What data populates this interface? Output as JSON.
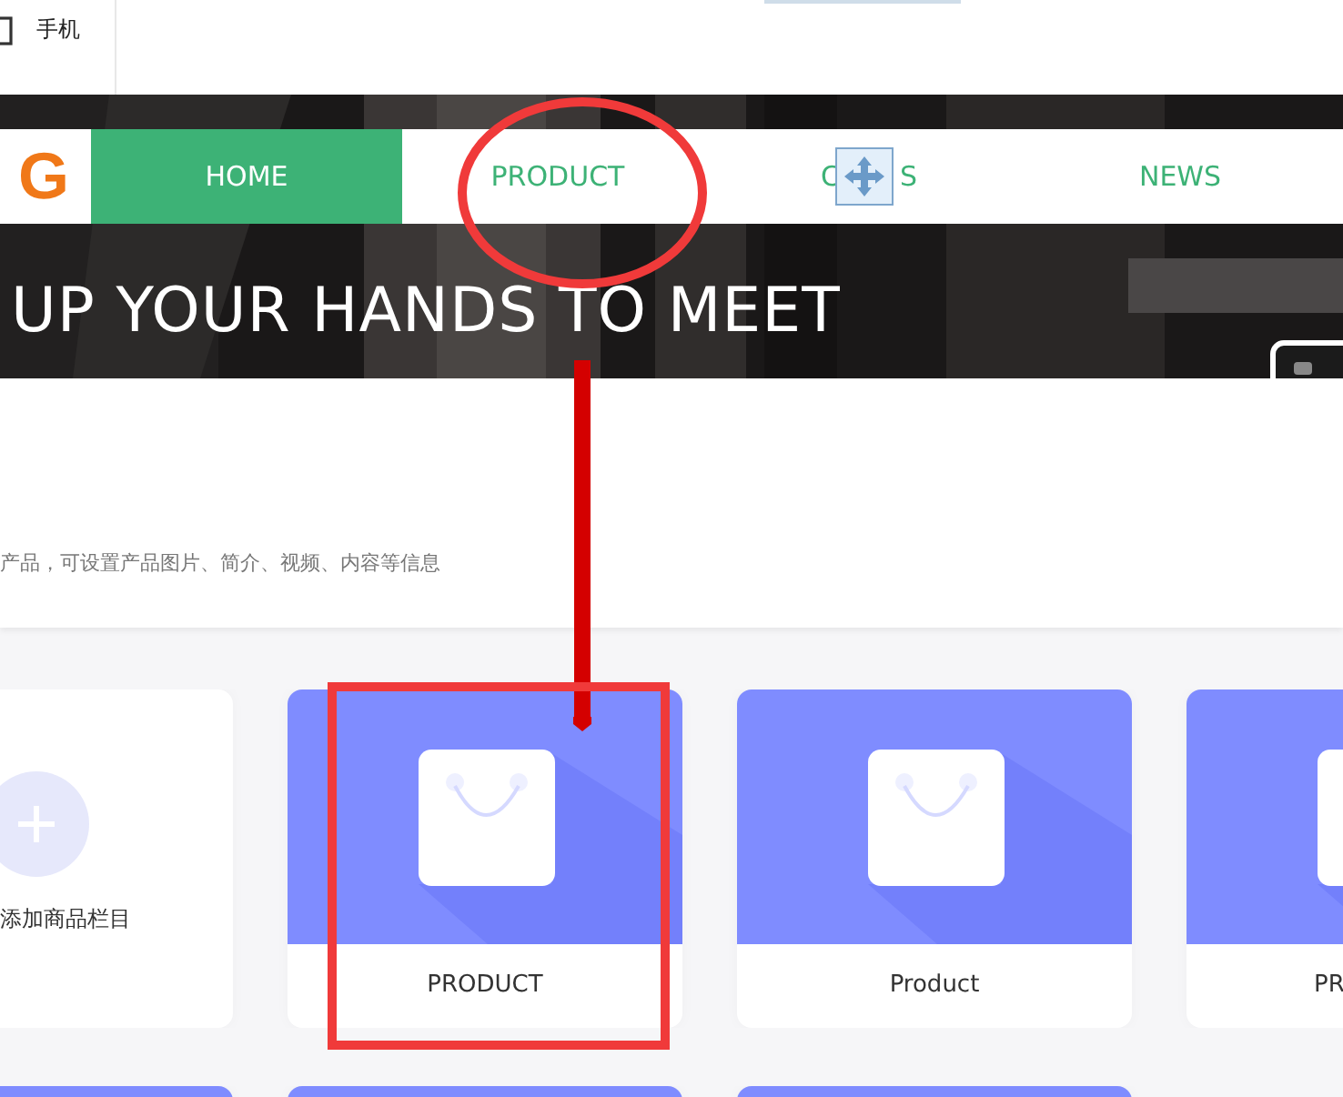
{
  "top_bar": {
    "device_label": "手机"
  },
  "nav": {
    "logo_text": "G",
    "items": [
      {
        "label": "HOME",
        "selected": true,
        "kind": "plain"
      },
      {
        "label": "PRODUCT",
        "selected": false,
        "kind": "plain"
      },
      {
        "label": "C",
        "label_end": "S",
        "selected": false,
        "kind": "covered"
      },
      {
        "label": "NEWS",
        "selected": false,
        "kind": "plain"
      }
    ]
  },
  "banner": {
    "headline": "UP YOUR HANDS TO MEET"
  },
  "section": {
    "description": "产品，可设置产品图片、简介、视频、内容等信息"
  },
  "cards": [
    {
      "kind": "add",
      "label": "添加商品栏目"
    },
    {
      "kind": "product",
      "label": "PRODUCT"
    },
    {
      "kind": "product",
      "label": "Product"
    },
    {
      "kind": "product",
      "label": "PR"
    }
  ],
  "second_row": [
    {
      "kind": "product"
    },
    {
      "kind": "product"
    },
    {
      "kind": "product"
    }
  ],
  "annotations": [
    {
      "kind": "ellipse"
    },
    {
      "kind": "arrow"
    },
    {
      "kind": "rect"
    }
  ]
}
